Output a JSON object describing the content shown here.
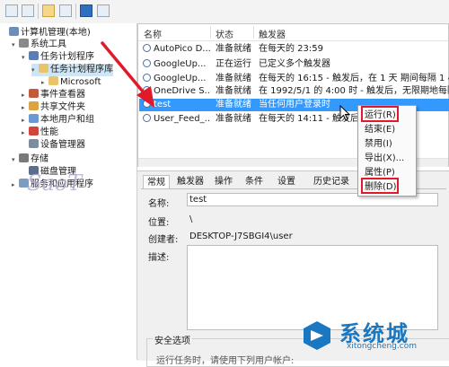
{
  "tree": [
    {
      "label": "计算机管理(本地)",
      "depth": 0,
      "arrow": "",
      "icon": "computer-icon"
    },
    {
      "label": "系统工具",
      "depth": 1,
      "arrow": "▾",
      "icon": "tools-icon"
    },
    {
      "label": "任务计划程序",
      "depth": 2,
      "arrow": "▾",
      "icon": "clock-icon"
    },
    {
      "label": "任务计划程序库",
      "depth": 3,
      "arrow": "▾",
      "icon": "folder-icon",
      "selected": true
    },
    {
      "label": "Microsoft",
      "depth": 4,
      "arrow": "▸",
      "icon": "folder-icon"
    },
    {
      "label": "事件查看器",
      "depth": 2,
      "arrow": "▸",
      "icon": "event-icon"
    },
    {
      "label": "共享文件夹",
      "depth": 2,
      "arrow": "▸",
      "icon": "share-icon"
    },
    {
      "label": "本地用户和组",
      "depth": 2,
      "arrow": "▸",
      "icon": "users-icon"
    },
    {
      "label": "性能",
      "depth": 2,
      "arrow": "▸",
      "icon": "performance-icon"
    },
    {
      "label": "设备管理器",
      "depth": 2,
      "arrow": "",
      "icon": "device-icon"
    },
    {
      "label": "存储",
      "depth": 1,
      "arrow": "▾",
      "icon": "storage-icon"
    },
    {
      "label": "磁盘管理",
      "depth": 2,
      "arrow": "",
      "icon": "disk-icon"
    },
    {
      "label": "服务和应用程序",
      "depth": 1,
      "arrow": "▸",
      "icon": "services-icon"
    }
  ],
  "table": {
    "headers": [
      "名称",
      "状态",
      "触发器"
    ],
    "rows": [
      {
        "name": "AutoPico D...",
        "status": "准备就绪",
        "trigger": "在每天的 23:59"
      },
      {
        "name": "GoogleUp...",
        "status": "正在运行",
        "trigger": "已定义多个触发器"
      },
      {
        "name": "GoogleUp...",
        "status": "准备就绪",
        "trigger": "在每天的 16:15 - 触发后，在 1 天 期间每隔 1 小时"
      },
      {
        "name": "OneDrive S...",
        "status": "准备就绪",
        "trigger": "在 1992/5/1 的 4:00 时 - 触发后，无限期地每隔 1"
      },
      {
        "name": "test",
        "status": "准备就绪",
        "trigger": "当任何用户登录时",
        "selected": true
      },
      {
        "name": "User_Feed_...",
        "status": "准备就绪",
        "trigger": "在每天的 14:11 - 触发后"
      }
    ]
  },
  "tabs": [
    "常规",
    "触发器",
    "操作",
    "条件",
    "设置",
    "历史记录"
  ],
  "form": {
    "name_label": "名称:",
    "name_value": "test",
    "location_label": "位置:",
    "location_value": "\\",
    "author_label": "创建者:",
    "author_value": "DESKTOP-J7SBGI4\\user",
    "desc_label": "描述:",
    "security_title": "安全选项",
    "security_text": "运行任务时，请使用下列用户帐户:"
  },
  "context_menu": [
    "运行(R)",
    "结束(E)",
    "禁用(I)",
    "导出(X)...",
    "属性(P)",
    "删除(D)"
  ],
  "watermark": {
    "left": "SaoT",
    "title": "系统城",
    "url": "xitongcheng.com"
  },
  "colors": {
    "selection": "#3399ff",
    "annotation_red": "#e0192b",
    "watermark_blue": "#1a78c2"
  }
}
